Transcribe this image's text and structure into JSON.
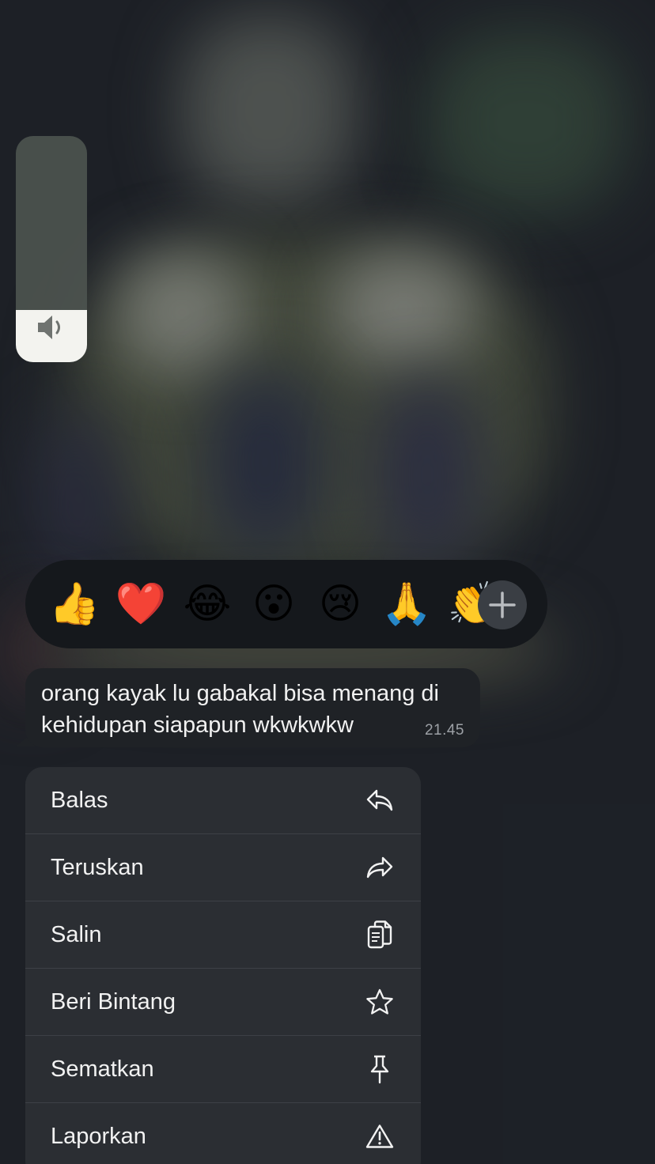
{
  "volume": {
    "level": 0.23,
    "icon": "speaker-icon"
  },
  "reactions": {
    "emojis": [
      {
        "name": "thumbs-up-emoji",
        "char": "👍"
      },
      {
        "name": "red-heart-emoji",
        "char": "❤️"
      },
      {
        "name": "tears-of-joy-emoji",
        "char": "😂"
      },
      {
        "name": "surprised-emoji",
        "char": "😮"
      },
      {
        "name": "crying-emoji",
        "char": "😢"
      },
      {
        "name": "folded-hands-emoji",
        "char": "🙏"
      },
      {
        "name": "clapping-hands-emoji",
        "char": "👏"
      }
    ],
    "more_icon": "plus-icon"
  },
  "message": {
    "text": "orang kayak lu gabakal bisa menang di kehidupan siapapun wkwkwkw",
    "time": "21.45"
  },
  "menu": {
    "items": [
      {
        "label": "Balas",
        "icon": "reply-icon"
      },
      {
        "label": "Teruskan",
        "icon": "forward-icon"
      },
      {
        "label": "Salin",
        "icon": "copy-icon"
      },
      {
        "label": "Beri Bintang",
        "icon": "star-icon"
      },
      {
        "label": "Sematkan",
        "icon": "pin-icon"
      },
      {
        "label": "Laporkan",
        "icon": "warning-icon"
      }
    ]
  },
  "colors": {
    "background": "#1f2329",
    "menu_bg": "#2b2e33",
    "bubble_bg": "#1f2226",
    "reaction_bar_bg": "#15181c"
  }
}
